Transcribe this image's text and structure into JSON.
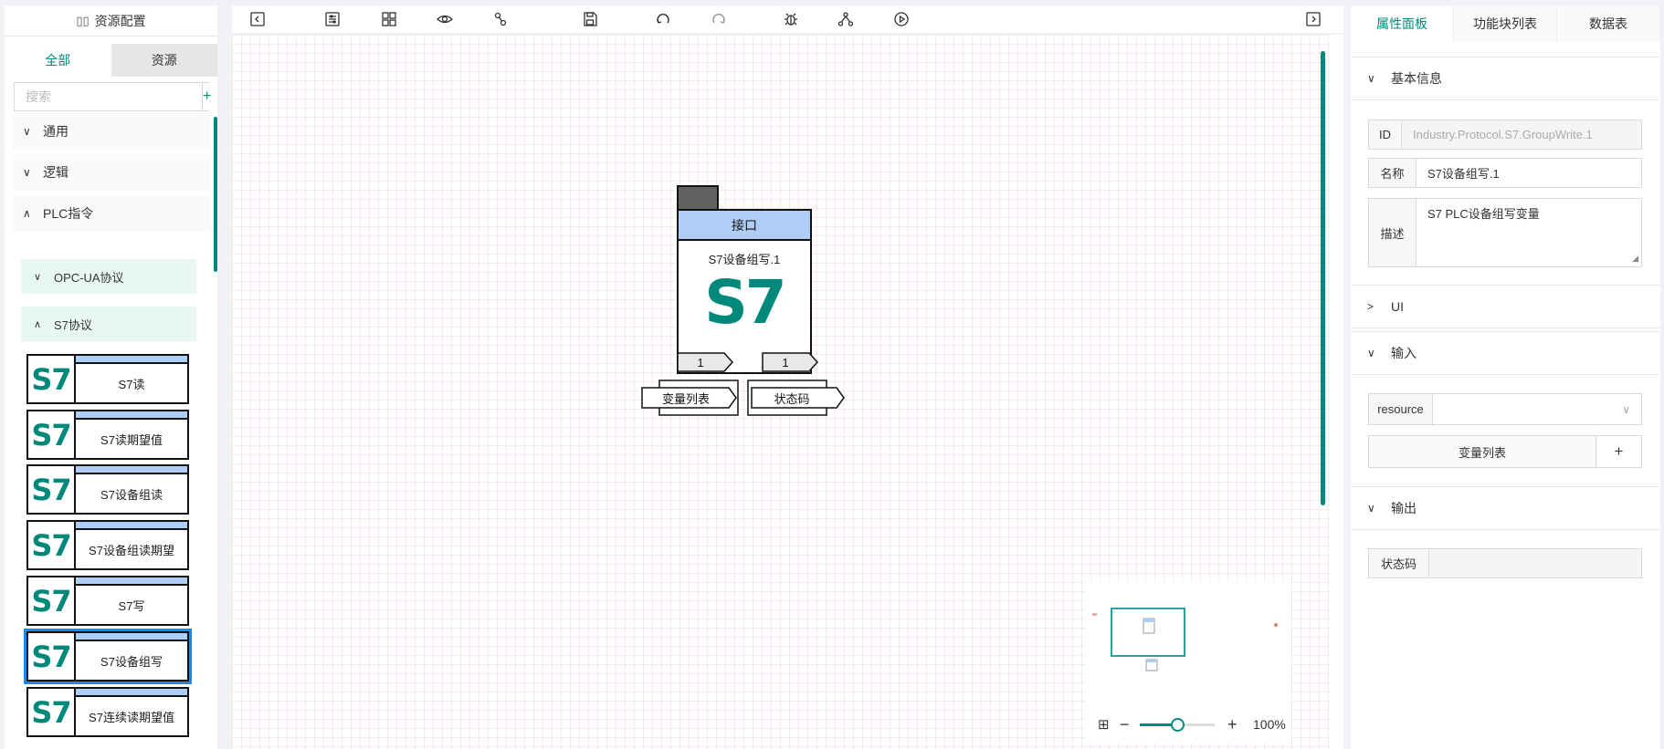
{
  "left_panel": {
    "header_title": "资源配置",
    "tabs": [
      {
        "label": "全部",
        "active": true
      },
      {
        "label": "资源",
        "active": false
      }
    ],
    "search_placeholder": "搜索",
    "add_label": "+",
    "categories": [
      {
        "label": "通用",
        "expanded": false
      },
      {
        "label": "逻辑",
        "expanded": false
      },
      {
        "label": "PLC指令",
        "expanded": true
      }
    ],
    "subcategories": [
      {
        "label": "OPC-UA协议",
        "expanded": false
      },
      {
        "label": "S7协议",
        "expanded": true
      }
    ],
    "blocks": [
      {
        "logo": "S7",
        "label": "S7读",
        "selected": false
      },
      {
        "logo": "S7",
        "label": "S7读期望值",
        "selected": false
      },
      {
        "logo": "S7",
        "label": "S7设备组读",
        "selected": false
      },
      {
        "logo": "S7",
        "label": "S7设备组读期望",
        "selected": false
      },
      {
        "logo": "S7",
        "label": "S7写",
        "selected": false
      },
      {
        "logo": "S7",
        "label": "S7设备组写",
        "selected": true
      },
      {
        "logo": "S7",
        "label": "S7连续读期望值",
        "selected": false
      }
    ]
  },
  "toolbar": {
    "icons": [
      "collapse-left-icon",
      "settings-sliders-icon",
      "layout-grid-icon",
      "preview-eye-icon",
      "link-nodes-icon",
      "save-icon",
      "undo-icon",
      "redo-icon",
      "debug-bug-icon",
      "tree-network-icon",
      "run-play-icon",
      "collapse-right-icon"
    ]
  },
  "canvas": {
    "node": {
      "header": "接口",
      "name": "S7设备组写.1",
      "logo": "S7",
      "input_port": "1",
      "output_port": "1",
      "input_label": "变量列表",
      "output_label": "状态码"
    },
    "zoom": "100%",
    "zoom_level": 0.5
  },
  "right_panel": {
    "tabs": [
      {
        "label": "属性面板",
        "active": true
      },
      {
        "label": "功能块列表",
        "active": false
      },
      {
        "label": "数据表",
        "active": false
      }
    ],
    "sections": {
      "basic": "基本信息",
      "ui": "UI",
      "input": "输入",
      "output": "输出"
    },
    "fields": {
      "id_label": "ID",
      "id_value": "Industry.Protocol.S7.GroupWrite.1",
      "name_label": "名称",
      "name_value": "S7设备组写.1",
      "desc_label": "描述",
      "desc_value": "S7 PLC设备组写变量",
      "resource_label": "resource",
      "resource_value": "",
      "var_list_button": "变量列表",
      "var_list_add": "+",
      "status_label": "状态码",
      "status_value": ""
    }
  },
  "colors": {
    "accent": "#00897b",
    "block_header": "#aecdf7",
    "selected_outline": "#1e88e5"
  }
}
